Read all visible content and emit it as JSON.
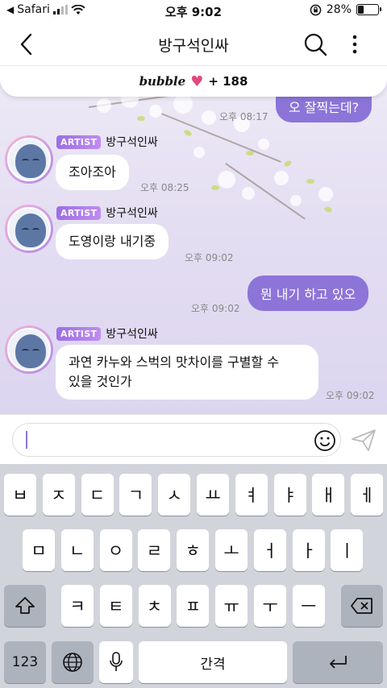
{
  "status_bar": {
    "carrier": "Safari",
    "time": "오후 9:02",
    "battery": "28%",
    "battery_level": 0.28
  },
  "nav": {
    "title": "방구석인싸"
  },
  "bubble_banner": {
    "logo": "bubble",
    "count": "+ 188"
  },
  "messages": [
    {
      "type": "out",
      "text": "오 잘찍는데?",
      "time": "오후 08:17"
    },
    {
      "type": "in",
      "badge": "ARTIST",
      "sender": "방구석인싸",
      "text": "조아조아",
      "time": "오후 08:25"
    },
    {
      "type": "in",
      "badge": "ARTIST",
      "sender": "방구석인싸",
      "text": "도영이랑 내기중",
      "time": "오후 09:02"
    },
    {
      "type": "out",
      "text": "뭔 내기 하고 있오",
      "time": "오후 09:02"
    },
    {
      "type": "in",
      "badge": "ARTIST",
      "sender": "방구석인싸",
      "text_lines": [
        "과연 카누와 스벅의 맛차이를 구별할 수",
        "있을 것인가"
      ],
      "time": "오후 09:02"
    }
  ],
  "keyboard": {
    "row1": [
      "ㅂ",
      "ㅈ",
      "ㄷ",
      "ㄱ",
      "ㅅ",
      "ㅛ",
      "ㅕ",
      "ㅑ",
      "ㅐ",
      "ㅔ"
    ],
    "row2": [
      "ㅁ",
      "ㄴ",
      "ㅇ",
      "ㄹ",
      "ㅎ",
      "ㅗ",
      "ㅓ",
      "ㅏ",
      "ㅣ"
    ],
    "row3": [
      "ㅋ",
      "ㅌ",
      "ㅊ",
      "ㅍ",
      "ㅠ",
      "ㅜ",
      "ㅡ"
    ],
    "numbers_key": "123",
    "space_key": "간격"
  },
  "colors": {
    "accent": "#8c74d9",
    "heart": "#e2487c"
  }
}
